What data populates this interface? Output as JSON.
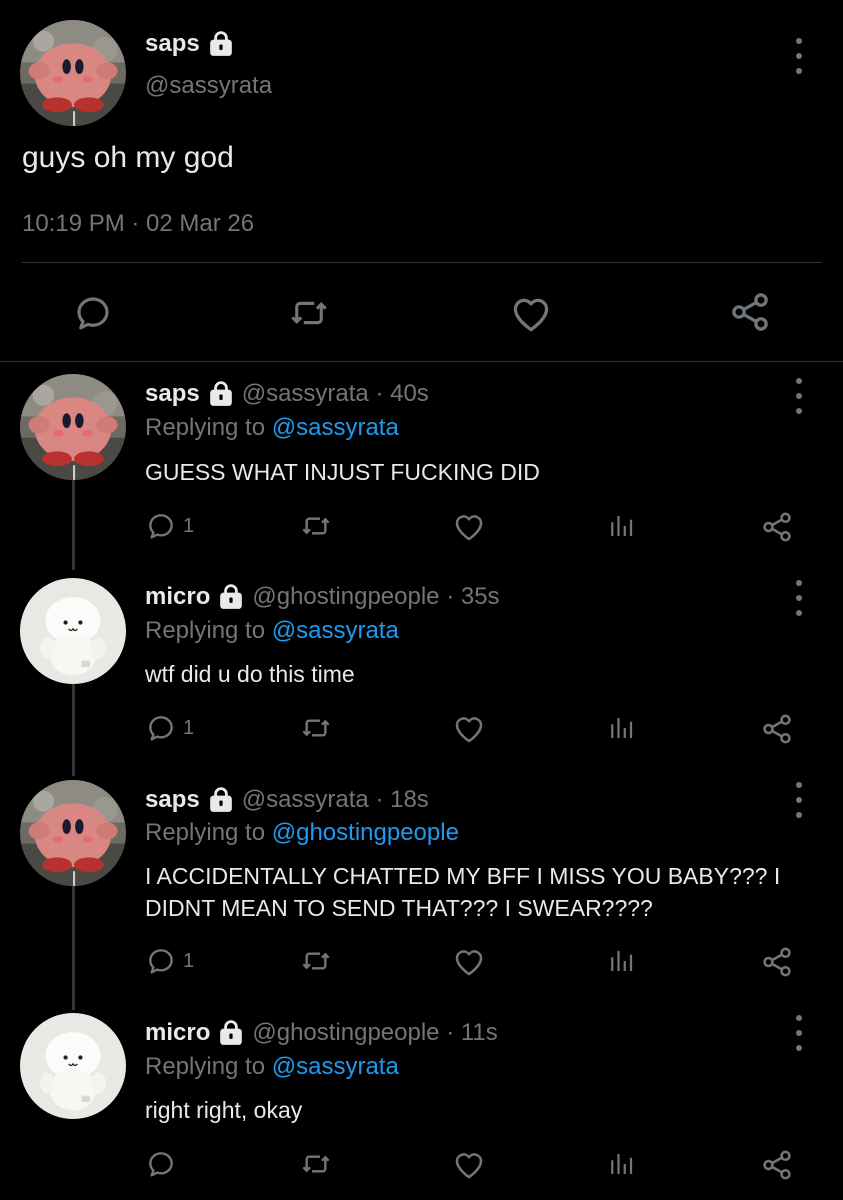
{
  "main_tweet": {
    "name": "saps",
    "handle": "@sassyrata",
    "text": "guys oh my god",
    "timestamp": "10:19 PM · 02 Mar 26",
    "actions": [
      "reply-icon",
      "retweet-icon",
      "like-icon",
      "share-icon"
    ]
  },
  "replies": [
    {
      "name": "saps",
      "handle": "@sassyrata · 40s",
      "replying_prefix": "Replying to",
      "replying_to": "@sassyrata",
      "text": "GUESS WHAT INJUST FUCKING DID",
      "reply_count": "1",
      "avatar": "kirby-plush"
    },
    {
      "name": "micro",
      "handle": "@ghostingpeople · 35s",
      "replying_prefix": "Replying to",
      "replying_to": "@sassyrata",
      "text": "wtf did u do this time",
      "reply_count": "1",
      "avatar": "white-plush"
    },
    {
      "name": "saps",
      "handle": "@sassyrata · 18s",
      "replying_prefix": "Replying to",
      "replying_to": "@ghostingpeople",
      "text": "I ACCIDENTALLY CHATTED MY BFF I MISS YOU BABY??? I DIDNT MEAN TO SEND THAT??? I SWEAR????",
      "reply_count": "1",
      "avatar": "kirby-plush"
    },
    {
      "name": "micro",
      "handle": "@ghostingpeople · 11s",
      "replying_prefix": "Replying to",
      "replying_to": "@sassyrata",
      "text": "right right, okay",
      "reply_count": "",
      "avatar": "white-plush"
    }
  ],
  "colors": {
    "background": "#000000",
    "text": "#e7e9ea",
    "muted": "#71767b",
    "link": "#1d9bf0",
    "divider": "#2f3336"
  }
}
